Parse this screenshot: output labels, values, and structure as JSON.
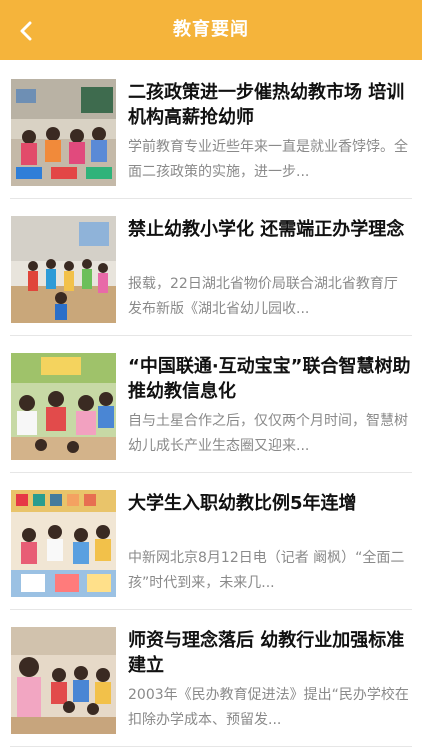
{
  "header": {
    "title": "教育要闻",
    "back_icon": "chevron-left-icon",
    "background_color": "#F5B43B"
  },
  "articles": [
    {
      "headline": "二孩政策进一步催热幼教市场 培训机构高薪抢幼师",
      "summary": "学前教育专业近些年来一直是就业香饽饽。全面二孩政策的实施，进一步..."
    },
    {
      "headline": "禁止幼教小学化 还需端正办学理念",
      "summary": "报载，22日湖北省物价局联合湖北省教育厅发布新版《湖北省幼儿园收..."
    },
    {
      "headline": "“中国联通·互动宝宝”联合智慧树助推幼教信息化",
      "summary": "自与土星合作之后，仅仅两个月时间，智慧树幼儿成长产业生态圈又迎来..."
    },
    {
      "headline": "大学生入职幼教比例5年连增",
      "summary": "中新网北京8月12日电（记者 阚枫）“全面二孩”时代到来，未来几..."
    },
    {
      "headline": "师资与理念落后 幼教行业加强标准建立",
      "summary": "2003年《民办教育促进法》提出“民办学校在扣除办学成本、预留发..."
    }
  ]
}
